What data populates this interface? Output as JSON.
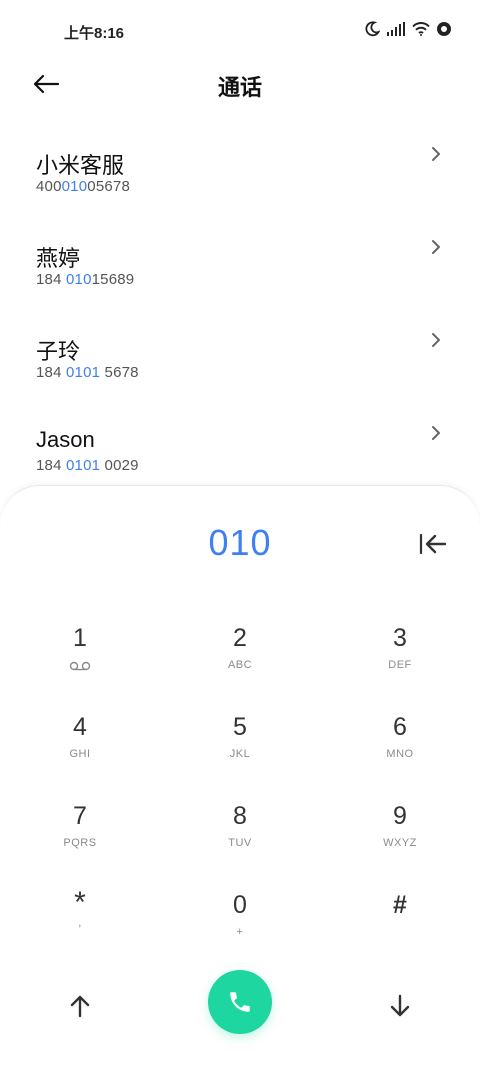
{
  "status_bar": {
    "time": "上午8:16",
    "icons": [
      "moon-icon",
      "signal-icon",
      "wifi-icon",
      "record-icon"
    ]
  },
  "header": {
    "title": "通话"
  },
  "contacts": [
    {
      "name": "小米客服",
      "number_before": "400",
      "number_match": "010",
      "number_after": "05678"
    },
    {
      "name": "燕婷",
      "number_before": "184 ",
      "number_match": "010",
      "number_after": "15689"
    },
    {
      "name": "子玲",
      "number_before": "184 ",
      "number_match": "0101",
      "number_after": " 5678"
    },
    {
      "name": "Jason",
      "number_before": "184 ",
      "number_match": "0101",
      "number_after": " 0029"
    }
  ],
  "dialer": {
    "dialed_number": "010",
    "keys": [
      {
        "digit": "1",
        "letters": ""
      },
      {
        "digit": "2",
        "letters": "ABC"
      },
      {
        "digit": "3",
        "letters": "DEF"
      },
      {
        "digit": "4",
        "letters": "GHI"
      },
      {
        "digit": "5",
        "letters": "JKL"
      },
      {
        "digit": "6",
        "letters": "MNO"
      },
      {
        "digit": "7",
        "letters": "PQRS"
      },
      {
        "digit": "8",
        "letters": "TUV"
      },
      {
        "digit": "9",
        "letters": "WXYZ"
      },
      {
        "digit": "*",
        "letters": ","
      },
      {
        "digit": "0",
        "letters": "+"
      },
      {
        "digit": "#",
        "letters": ""
      }
    ]
  },
  "colors": {
    "accent_blue": "#3f7ff0",
    "call_green": "#1ed6a0"
  }
}
